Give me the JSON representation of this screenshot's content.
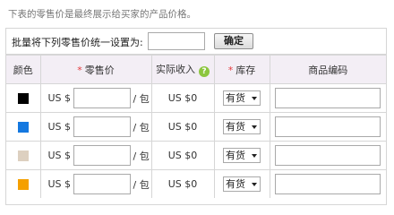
{
  "note": "下表的零售价是最终展示给买家的产品价格。",
  "batch": {
    "label": "批量将下列零售价统一设置为:",
    "input_value": "",
    "confirm_label": "确定"
  },
  "headers": {
    "color": "颜色",
    "retail_price": "零售价",
    "required_mark": "*",
    "actual_income": "实际收入",
    "help_icon_glyph": "?",
    "stock": "库存",
    "product_code": "商品编码"
  },
  "rows": [
    {
      "color_hex": "#000000",
      "currency": "US $",
      "price": "",
      "unit": "/ 包",
      "income": "US $0",
      "stock": "有货",
      "code": ""
    },
    {
      "color_hex": "#1478e0",
      "currency": "US $",
      "price": "",
      "unit": "/ 包",
      "income": "US $0",
      "stock": "有货",
      "code": ""
    },
    {
      "color_hex": "#ddd0c0",
      "currency": "US $",
      "price": "",
      "unit": "/ 包",
      "income": "US $0",
      "stock": "有货",
      "code": ""
    },
    {
      "color_hex": "#f5a000",
      "currency": "US $",
      "price": "",
      "unit": "/ 包",
      "income": "US $0",
      "stock": "有货",
      "code": ""
    }
  ]
}
